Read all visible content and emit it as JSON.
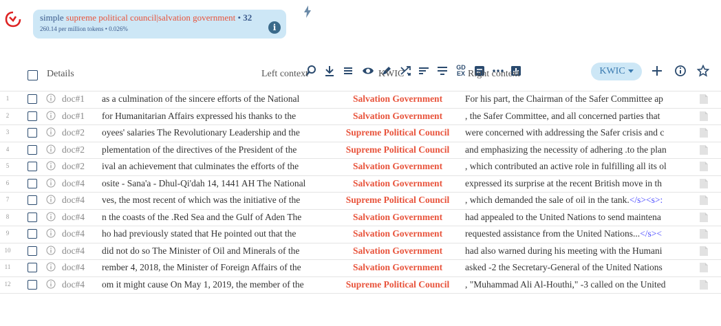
{
  "query": {
    "simple_label": "simple",
    "expression": "supreme political council|salvation government",
    "bullet": "•",
    "count": "32",
    "stats": "260.14 per million tokens • 0.026%",
    "info_label": "i"
  },
  "toolbar": {
    "icons": [
      "search-icon",
      "download-icon",
      "list-icon",
      "eye-icon",
      "pen-icon",
      "shuffle-icon",
      "sort-icon",
      "filter-icon",
      "gdex-icon",
      "concordance-icon",
      "more-icon",
      "chart-icon"
    ],
    "gdex_label": "GD\nEX",
    "view_mode": "KWIC",
    "accent": "#cde7f6"
  },
  "table": {
    "headers": {
      "details": "Details",
      "left": "Left context",
      "kwic": "KWIC",
      "right": "Right context"
    },
    "rows": [
      {
        "num": "1",
        "doc": "doc#1",
        "left": "as a culmination of the sincere efforts of the National",
        "kwic": "Salvation Government",
        "right": "For his part, the Chairman of the Safer Committee ap",
        "tag": ""
      },
      {
        "num": "2",
        "doc": "doc#1",
        "left": "for Humanitarian Affairs expressed his thanks to the",
        "kwic": "Salvation Government",
        "right": ", the Safer Committee, and all concerned parties that",
        "tag": ""
      },
      {
        "num": "3",
        "doc": "doc#2",
        "left": "oyees' salaries The Revolutionary Leadership and the",
        "kwic": "Supreme Political Council",
        "right": "were concerned with addressing the Safer crisis and c",
        "tag": ""
      },
      {
        "num": "4",
        "doc": "doc#2",
        "left": "plementation of the directives of the President of the",
        "kwic": "Supreme Political Council",
        "right": "and emphasizing the necessity of adhering .to the plan",
        "tag": ""
      },
      {
        "num": "5",
        "doc": "doc#2",
        "left": "ival an achievement that culminates the efforts of the",
        "kwic": "Salvation Government",
        "right": ", which contributed an active role in fulfilling all its ol",
        "tag": ""
      },
      {
        "num": "6",
        "doc": "doc#4",
        "left": "osite - Sana'a - Dhul-Qi'dah 14, 1441 AH The National",
        "kwic": "Salvation Government",
        "right": "expressed its surprise at the recent British move in th",
        "tag": ""
      },
      {
        "num": "7",
        "doc": "doc#4",
        "left": "ves, the most recent of which was the initiative of the",
        "kwic": "Supreme Political Council",
        "right": ", which demanded the sale of oil in the tank.",
        "tag": "</s><s>:"
      },
      {
        "num": "8",
        "doc": "doc#4",
        "left": "n the coasts of the .Red Sea and the Gulf of Aden The",
        "kwic": "Salvation Government",
        "right": "had appealed to the United Nations to send maintena",
        "tag": ""
      },
      {
        "num": "9",
        "doc": "doc#4",
        "left": "ho had previously stated that He pointed out that the",
        "kwic": "Salvation Government",
        "right": "requested assistance from the United Nations...",
        "tag": "</s><"
      },
      {
        "num": "10",
        "doc": "doc#4",
        "left": "did not do so The Minister of Oil and Minerals of the",
        "kwic": "Salvation Government",
        "right": "had also warned during his meeting with the Humani",
        "tag": ""
      },
      {
        "num": "11",
        "doc": "doc#4",
        "left": "rember 4, 2018, the Minister of Foreign Affairs of the",
        "kwic": "Salvation Government",
        "right": "asked -2 the Secretary-General of the United Nations",
        "tag": ""
      },
      {
        "num": "12",
        "doc": "doc#4",
        "left": "om it might cause On May 1, 2019, the member of the",
        "kwic": "Supreme Political Council",
        "right": ", \"Muhammad Ali Al-Houthi,\" -3 called on the United",
        "tag": ""
      }
    ]
  }
}
